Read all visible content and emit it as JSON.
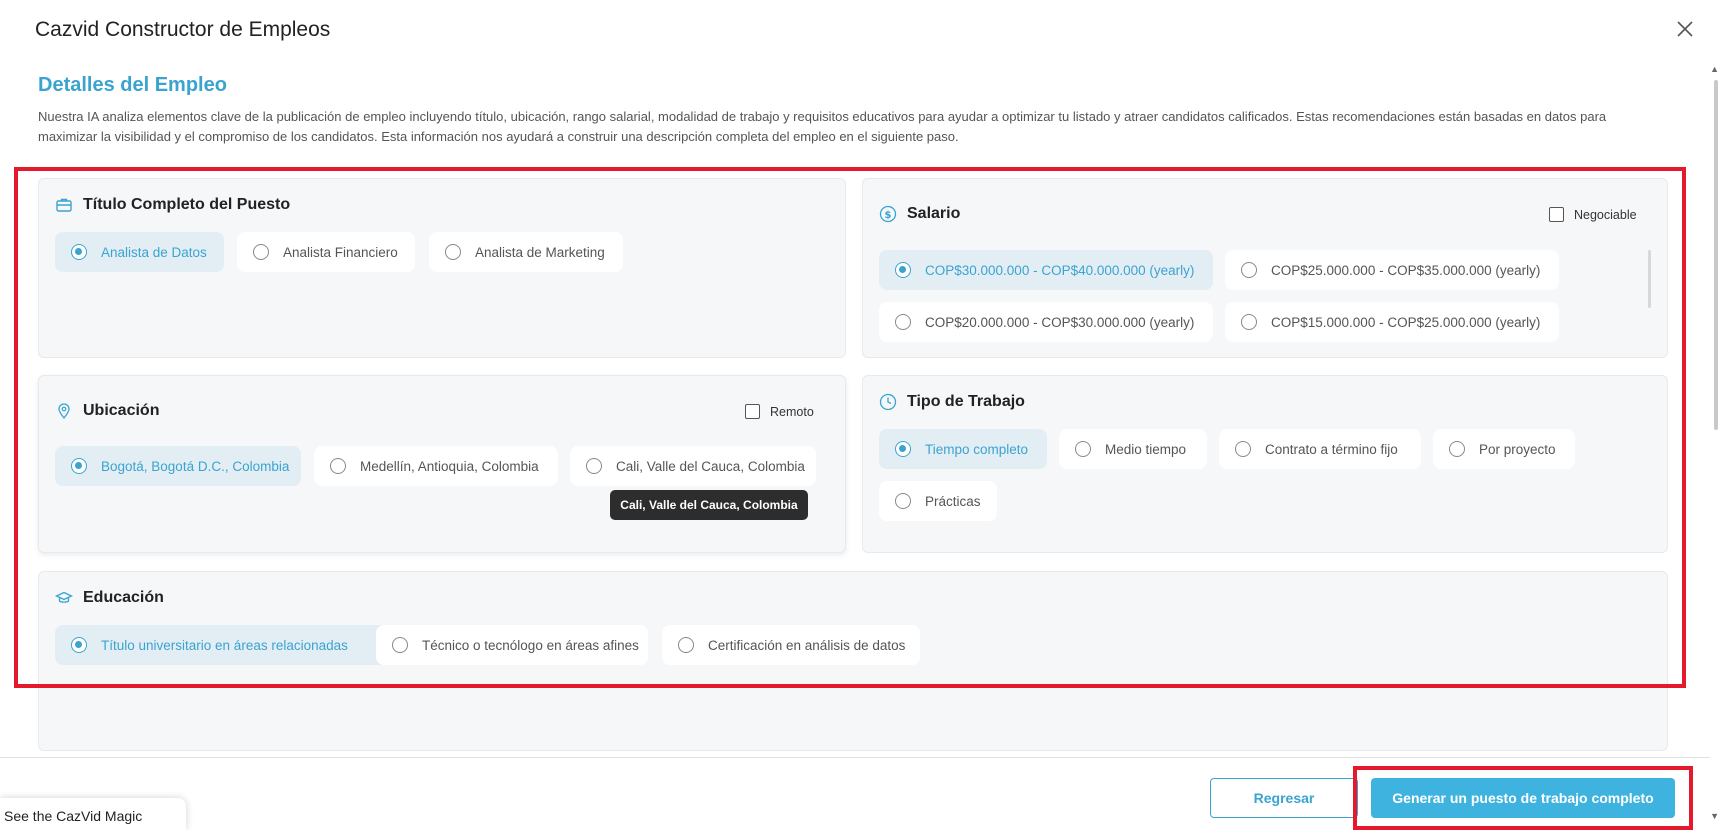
{
  "modal": {
    "title": "Cazvid Constructor de Empleos"
  },
  "section": {
    "title": "Detalles del Empleo",
    "description": "Nuestra IA analiza elementos clave de la publicación de empleo incluyendo título, ubicación, rango salarial, modalidad de trabajo y requisitos educativos para ayudar a optimizar tu listado y atraer candidatos calificados. Estas recomendaciones están basadas en datos para maximizar la visibilidad y el compromiso de los candidatos. Esta información nos ayudará a construir una descripción completa del empleo en el siguiente paso."
  },
  "title_card": {
    "heading": "Título Completo del Puesto",
    "icon": "briefcase-icon",
    "options": [
      "Analista de Datos",
      "Analista Financiero",
      "Analista de Marketing"
    ],
    "selected": "Analista de Datos"
  },
  "salary_card": {
    "heading": "Salario",
    "icon": "dollar-icon",
    "negotiable_label": "Negociable",
    "negotiable_checked": false,
    "options": [
      "COP$30.000.000 - COP$40.000.000 (yearly)",
      "COP$25.000.000 - COP$35.000.000 (yearly)",
      "COP$20.000.000 - COP$30.000.000 (yearly)",
      "COP$15.000.000 - COP$25.000.000 (yearly)"
    ],
    "selected": "COP$30.000.000 - COP$40.000.000 (yearly)"
  },
  "location_card": {
    "heading": "Ubicación",
    "icon": "location-pin-icon",
    "remote_label": "Remoto",
    "remote_checked": false,
    "options": [
      "Bogotá, Bogotá D.C., Colombia",
      "Medellín, Antioquia, Colombia",
      "Cali, Valle del Cauca, Colombia"
    ],
    "selected": "Bogotá, Bogotá D.C., Colombia",
    "tooltip": "Cali, Valle del Cauca, Colombia"
  },
  "worktype_card": {
    "heading": "Tipo de Trabajo",
    "icon": "clock-icon",
    "options": [
      "Tiempo completo",
      "Medio tiempo",
      "Contrato a término fijo",
      "Por proyecto",
      "Prácticas"
    ],
    "selected": "Tiempo completo"
  },
  "education_card": {
    "heading": "Educación",
    "icon": "graduation-cap-icon",
    "options": [
      "Título universitario en áreas relacionadas",
      "Técnico o tecnólogo en áreas afines",
      "Certificación en análisis de datos"
    ],
    "selected": "Título universitario en áreas relacionadas"
  },
  "footer": {
    "back_label": "Regresar",
    "generate_label": "Generar un puesto de trabajo completo"
  },
  "magic_tab": {
    "label": "See the CazVid Magic"
  },
  "colors": {
    "accent": "#3ba3d0",
    "button": "#3fb3e0",
    "highlight": "#e4192b"
  }
}
